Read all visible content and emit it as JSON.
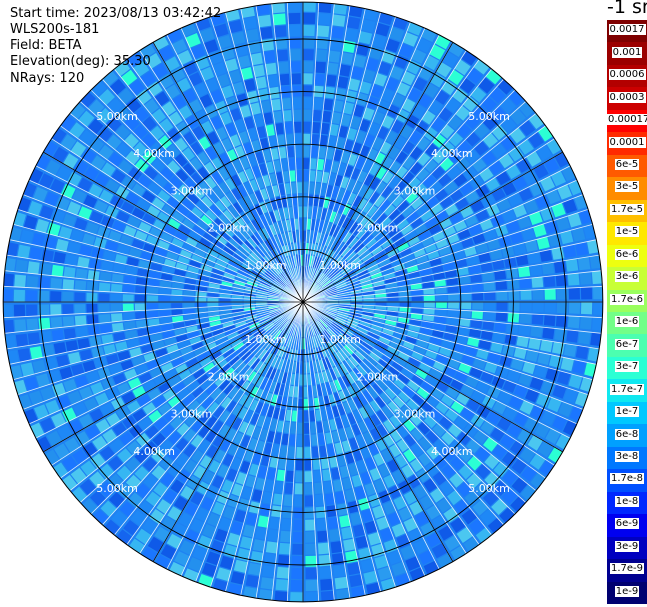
{
  "header": {
    "start_time": "Start time: 2023/08/13 03:42:42",
    "instrument": "WLS200s-181",
    "field": "Field: BETA",
    "elevation": "Elevation(deg): 35.30",
    "nrays": "NRays: 120"
  },
  "chart_data": {
    "type": "heatmap",
    "projection": "polar PPI scan",
    "field": "BETA",
    "n_rays": 120,
    "elevation_deg": 35.3,
    "range_rings_km": [
      1.0,
      2.0,
      3.0,
      4.0,
      5.0
    ],
    "range_labels": [
      "1.00km",
      "2.00km",
      "3.00km",
      "4.00km",
      "5.00km"
    ],
    "max_range_km": 5.7,
    "spokes_deg": [
      0,
      30,
      60,
      90,
      120,
      150,
      180,
      210,
      240,
      270,
      300,
      330
    ],
    "typical_value": "1e-8 to 6e-8 (blue)",
    "colorbar": {
      "units": "-1 sr",
      "scale": "log",
      "tick_labels": [
        "0.0017",
        "0.001",
        "0.0006",
        "0.0003",
        "0.00017",
        "0.0001",
        "6e-5",
        "3e-5",
        "1.7e-5",
        "1e-5",
        "6e-6",
        "3e-6",
        "1.7e-6",
        "1e-6",
        "6e-7",
        "3e-7",
        "1.7e-7",
        "1e-7",
        "6e-8",
        "3e-8",
        "1.7e-8",
        "1e-8",
        "6e-9",
        "3e-9",
        "1.7e-9",
        "1e-9"
      ],
      "colors": [
        "#7f0000",
        "#9b0000",
        "#b30000",
        "#cc0000",
        "#ff0000",
        "#ff2a00",
        "#ff5a00",
        "#ff8c00",
        "#ffbf00",
        "#ffe800",
        "#eeff10",
        "#c8ff36",
        "#9aff5e",
        "#72ff88",
        "#4cffb0",
        "#2bffd4",
        "#10e8f0",
        "#00c8ff",
        "#00a0ff",
        "#0078ff",
        "#0050ff",
        "#0028ff",
        "#0000f0",
        "#0000c0",
        "#000090",
        "#000070"
      ]
    }
  }
}
